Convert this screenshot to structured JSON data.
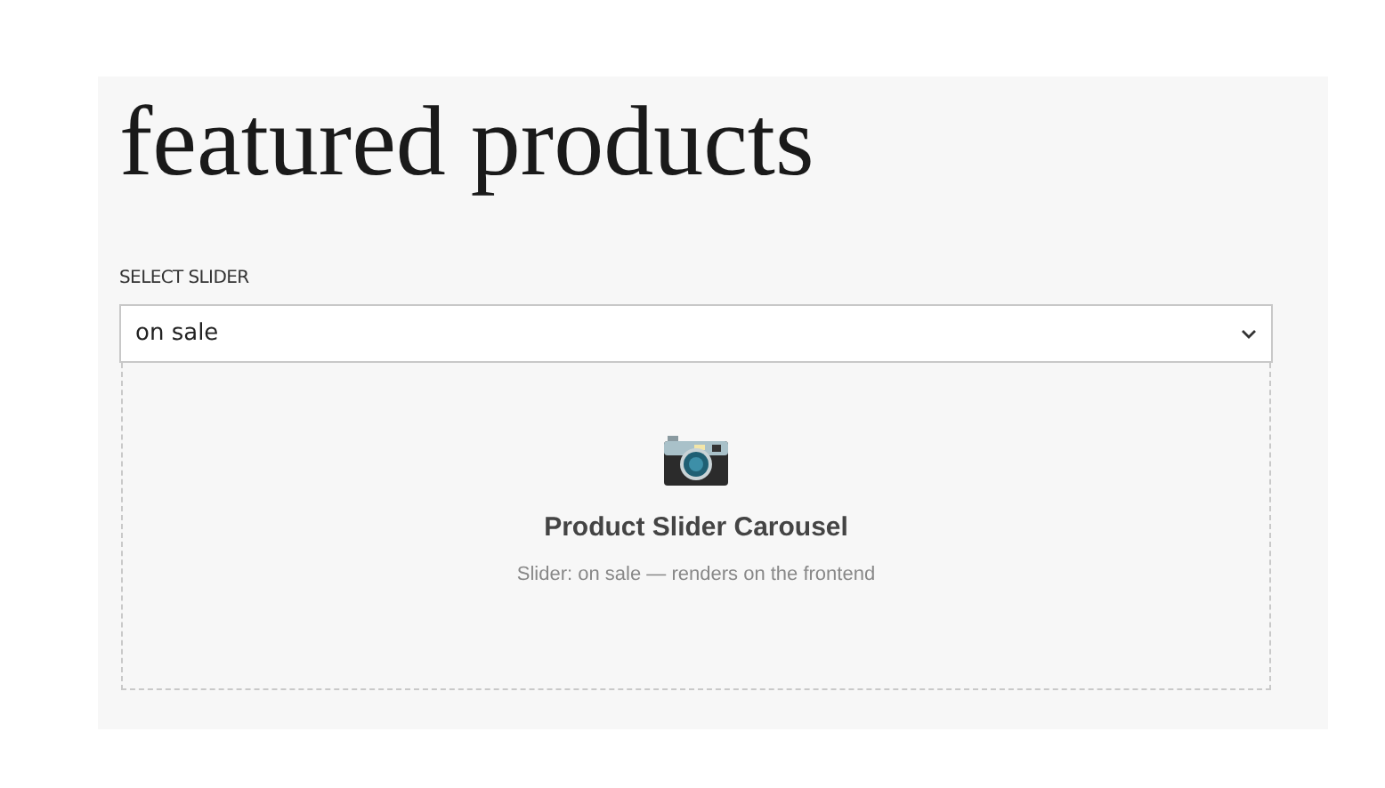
{
  "title": "featured products",
  "select": {
    "label": "SELECT SLIDER",
    "value": "on sale"
  },
  "preview": {
    "heading": "Product Slider Carousel",
    "caption": "Slider: on sale — renders on the frontend"
  }
}
